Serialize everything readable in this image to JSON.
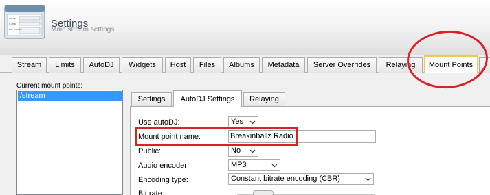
{
  "header": {
    "title": "Settings",
    "subtitle": "Main stream settings",
    "icon": "settings-form-icon",
    "icon_text": [
      "name",
      "e-mail",
      "comments"
    ]
  },
  "main_tabs": {
    "items": [
      {
        "label": "Stream"
      },
      {
        "label": "Limits"
      },
      {
        "label": "AutoDJ"
      },
      {
        "label": "Widgets"
      },
      {
        "label": "Host"
      },
      {
        "label": "Files"
      },
      {
        "label": "Albums"
      },
      {
        "label": "Metadata"
      },
      {
        "label": "Server Overrides"
      },
      {
        "label": "Relaying"
      },
      {
        "label": "Mount Points"
      }
    ],
    "active": "Mount Points"
  },
  "mounts": {
    "label": "Current mount points:",
    "items": [
      "/stream"
    ]
  },
  "sub_tabs": {
    "items": [
      {
        "label": "Settings"
      },
      {
        "label": "AutoDJ Settings"
      },
      {
        "label": "Relaying"
      }
    ],
    "active": "AutoDJ Settings"
  },
  "form": {
    "use_autodj": {
      "label": "Use autoDJ:",
      "value": "Yes"
    },
    "mount_point_name": {
      "label": "Mount point name:",
      "value": "Breakinballz Radio"
    },
    "public": {
      "label": "Public:",
      "value": "No"
    },
    "audio_encoder": {
      "label": "Audio encoder:",
      "value": "MP3"
    },
    "encoding_type": {
      "label": "Encoding type:",
      "value": "Constant bitrate encoding (CBR)"
    },
    "bit_rate": {
      "label": "Bit rate:"
    }
  },
  "colors": {
    "annotation": "#dd1f26",
    "selection": "#3399ff",
    "active_tab_accent": "#f2c94c"
  }
}
